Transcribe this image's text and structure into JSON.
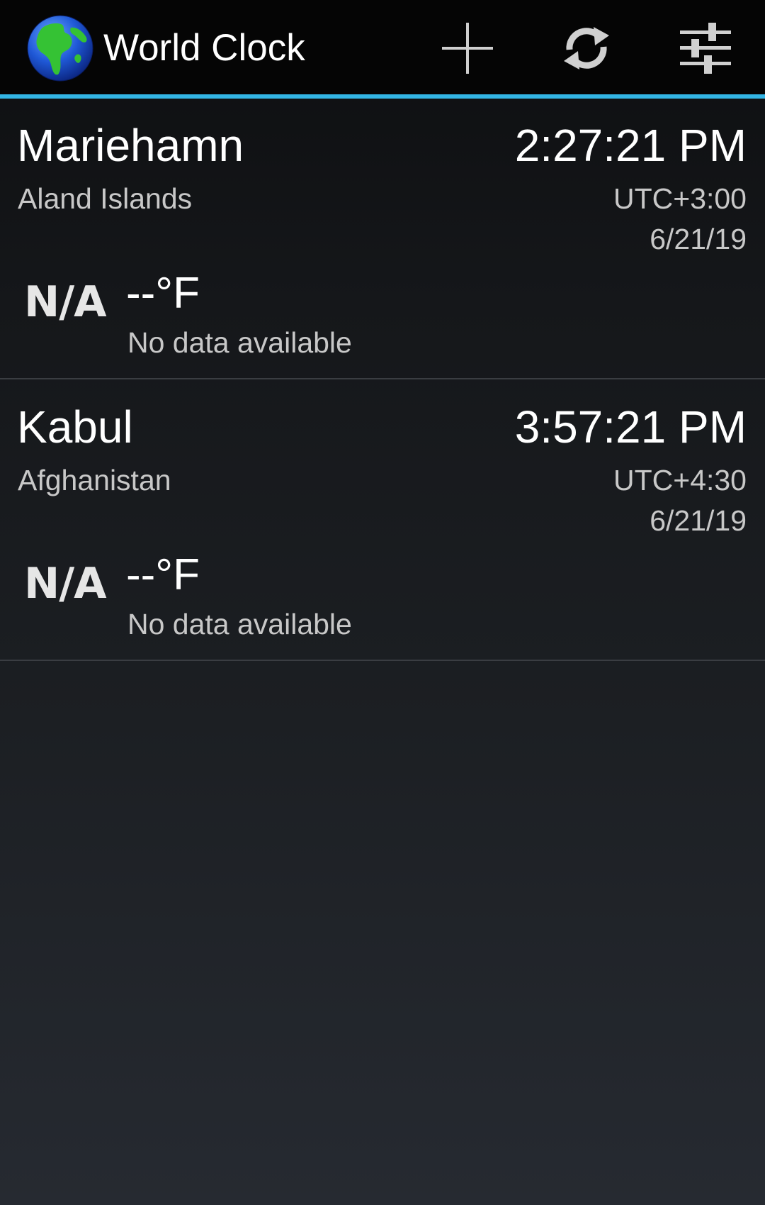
{
  "action_bar": {
    "title": "World Clock",
    "logo_icon": "globe-icon",
    "actions": [
      {
        "name": "add-city",
        "icon": "plus-icon"
      },
      {
        "name": "refresh",
        "icon": "refresh-icon"
      },
      {
        "name": "settings",
        "icon": "sliders-icon"
      }
    ],
    "accent_color": "#33b5e5"
  },
  "cities": [
    {
      "name": "Mariehamn",
      "country": "Aland Islands",
      "time": "2:27:21 PM",
      "utc_offset": "UTC+3:00",
      "date": "6/21/19",
      "weather_icon_text": "N/A",
      "temperature": "--°F",
      "condition": "No data available"
    },
    {
      "name": "Kabul",
      "country": "Afghanistan",
      "time": "3:57:21 PM",
      "utc_offset": "UTC+4:30",
      "date": "6/21/19",
      "weather_icon_text": "N/A",
      "temperature": "--°F",
      "condition": "No data available"
    }
  ]
}
